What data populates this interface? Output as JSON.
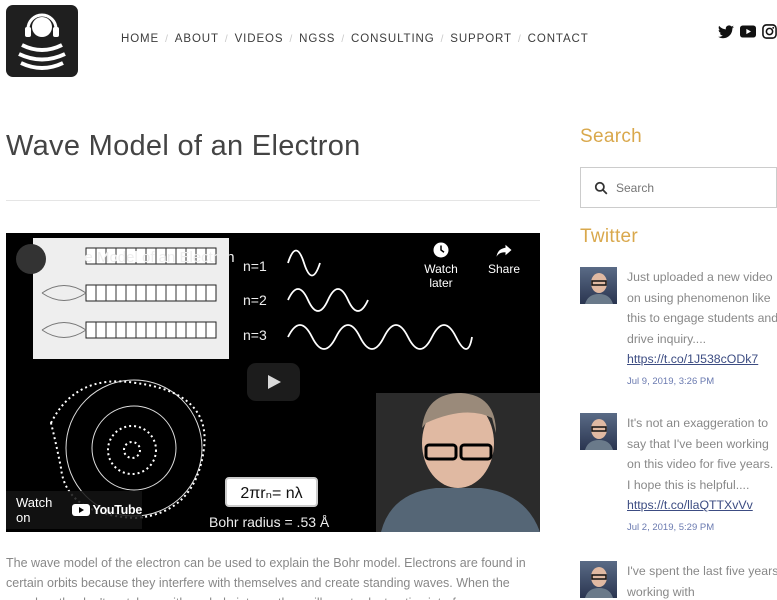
{
  "nav": {
    "items": [
      "HOME",
      "ABOUT",
      "VIDEOS",
      "NGSS",
      "CONSULTING",
      "SUPPORT",
      "CONTACT"
    ],
    "separator": "/"
  },
  "social": [
    "twitter-icon",
    "youtube-icon",
    "instagram-icon"
  ],
  "article": {
    "title": "Wave Model of an Electron",
    "description": "The wave model of the electron can be used to explain the Bohr model. Electrons are found in certain orbits because they interfere with themselves and create standing waves. When the wavelengths don't match up with a whole integer they will create destructive interference."
  },
  "video": {
    "title": "Wave Model of an Electron",
    "watch_later": "Watch later",
    "share": "Share",
    "watch_on": "Watch on",
    "youtube": "YouTube",
    "formula": "2πrₙ= nλ",
    "bohr_radius": "Bohr radius = .53 Å",
    "levels": [
      "n=1",
      "n=2",
      "n=3"
    ]
  },
  "sidebar": {
    "search_heading": "Search",
    "search_placeholder": "Search",
    "twitter_heading": "Twitter",
    "tweets": [
      {
        "text": "Just uploaded a new video on using phenomenon like this to engage students and drive inquiry....",
        "link": "https://t.co/1J538cODk7",
        "date": "Jul 9, 2019, 3:26 PM"
      },
      {
        "text": "It's not an exaggeration to say that I've been working on this video for five years. I hope this is helpful....",
        "link": "https://t.co/llaQTTXvVv",
        "date": "Jul 2, 2019, 5:29 PM"
      },
      {
        "text": "I've spent the last five years working with",
        "link": "",
        "date": ""
      }
    ]
  },
  "colors": {
    "accent": "#d9a84c",
    "link": "#3c4c82"
  }
}
